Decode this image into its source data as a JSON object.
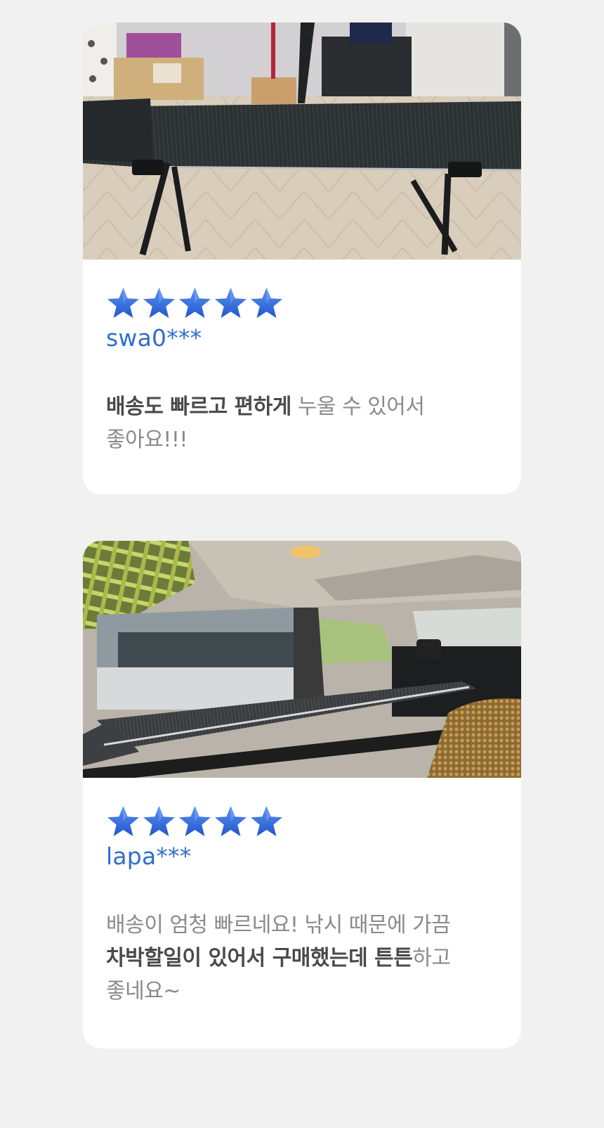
{
  "colors": {
    "background": "#f1f1f1",
    "card": "#ffffff",
    "star": "#2f6fe0",
    "reviewer": "#2f6ecf",
    "text_emphasis": "#4a4a4a",
    "text_muted": "#8a8a8a"
  },
  "reviews": [
    {
      "photo_icon": "folding-cot-photo",
      "rating": 5,
      "reviewer": "swa0***",
      "text": [
        {
          "value": "배송도 빠르고 편하게",
          "bold": true
        },
        {
          "value": " 누울 수 있어서",
          "bold": false
        },
        {
          "value": "좋아요!!!",
          "bold": false
        }
      ]
    },
    {
      "photo_icon": "car-cot-photo",
      "rating": 5,
      "reviewer": "lapa***",
      "text": [
        {
          "value": "배송이 엄청 빠르네요! 낚시 때문에 가끔",
          "bold": false
        },
        {
          "value": "차박할일이 있어서 구매했는데 튼튼",
          "bold": true
        },
        {
          "value": "하고",
          "bold": false
        },
        {
          "value": "좋네요~",
          "bold": false
        }
      ]
    }
  ]
}
